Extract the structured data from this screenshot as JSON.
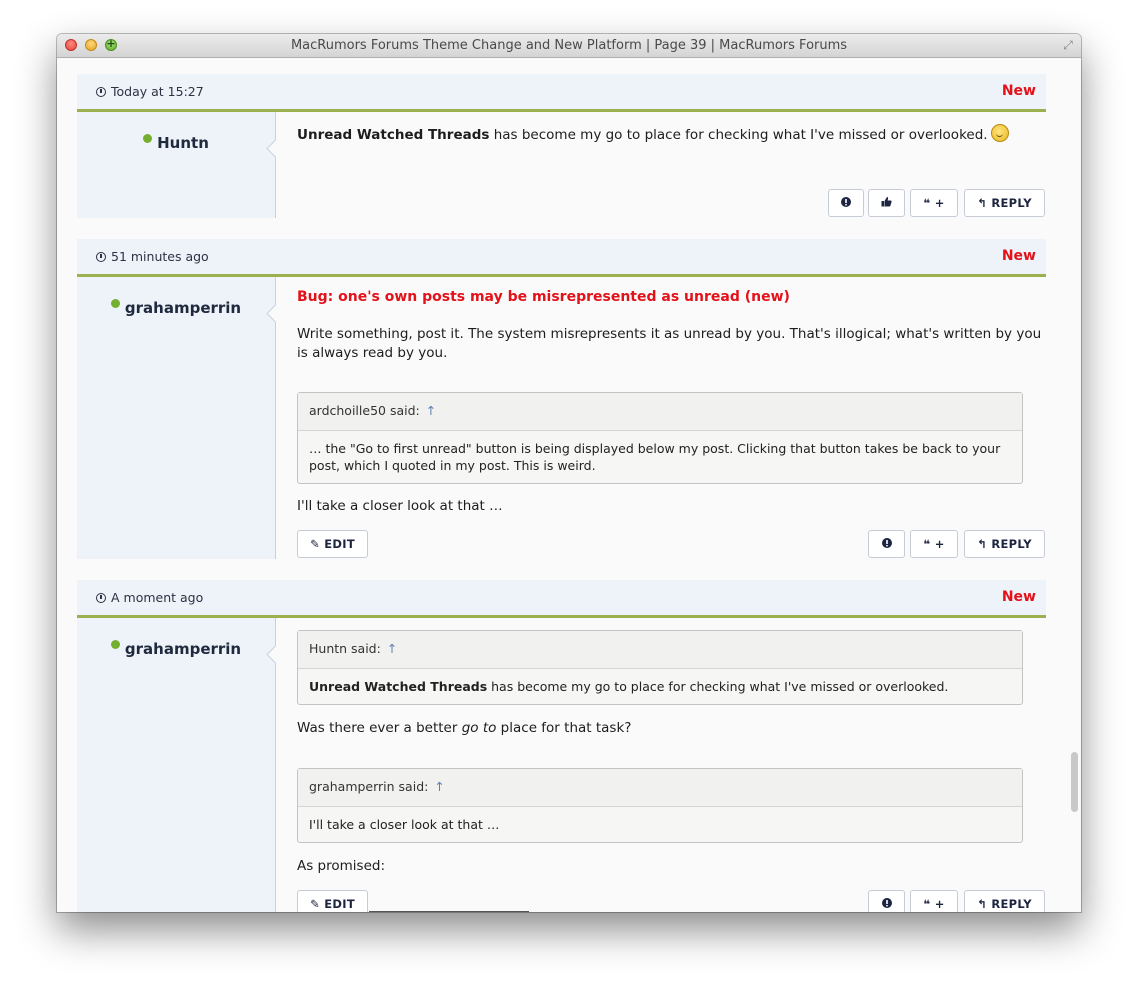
{
  "window": {
    "title": "MacRumors Forums Theme Change and New Platform | Page 39 | MacRumors Forums"
  },
  "posts": [
    {
      "time": "Today at 15:27",
      "new_badge": "New",
      "author": "Huntn",
      "body_bold": "Unread Watched Threads",
      "body_rest": " has become my go to place for checking what I've missed or overlooked.",
      "buttons": {
        "report": "!",
        "like": "like",
        "multiquote": "+",
        "reply": "REPLY"
      }
    },
    {
      "time": "51 minutes ago",
      "new_badge": "New",
      "author": "grahamperrin",
      "title": "Bug: one's own posts may be misrepresented as unread (new)",
      "paragraph": "Write something, post it. The system misrepresents it as unread by you. That's illogical; what's written by you is always read by you.",
      "quote": {
        "author": "ardchoille50 said:",
        "up": "↑",
        "text": "… the \"Go to first unread\" button is being displayed below my post. Clicking that button takes be back to your post, which I quoted in my post. This is weird."
      },
      "closing": "I'll take a closer look at that …",
      "buttons": {
        "edit": "EDIT",
        "report": "!",
        "multiquote": "+",
        "reply": "REPLY"
      }
    },
    {
      "time": "A moment ago",
      "new_badge": "New",
      "author": "grahamperrin",
      "quote1": {
        "author": "Huntn said:",
        "up": "↑",
        "text_bold": "Unread Watched Threads",
        "text_rest": " has become my go to place for checking what I've missed or overlooked."
      },
      "line_a": "Was there ever a better ",
      "line_a_em": "go to",
      "line_a_end": " place for that task?",
      "quote2": {
        "author": "grahamperrin said:",
        "up": "↑",
        "text": "I'll take a closer look at that …"
      },
      "closing": "As promised:",
      "buttons": {
        "edit": "EDIT",
        "report": "!",
        "multiquote": "+",
        "reply": "REPLY"
      }
    }
  ],
  "colors": {
    "new": "#e3111a",
    "header_bg": "#eef3f9",
    "divider": "#9cb050",
    "online": "#74b02d"
  }
}
